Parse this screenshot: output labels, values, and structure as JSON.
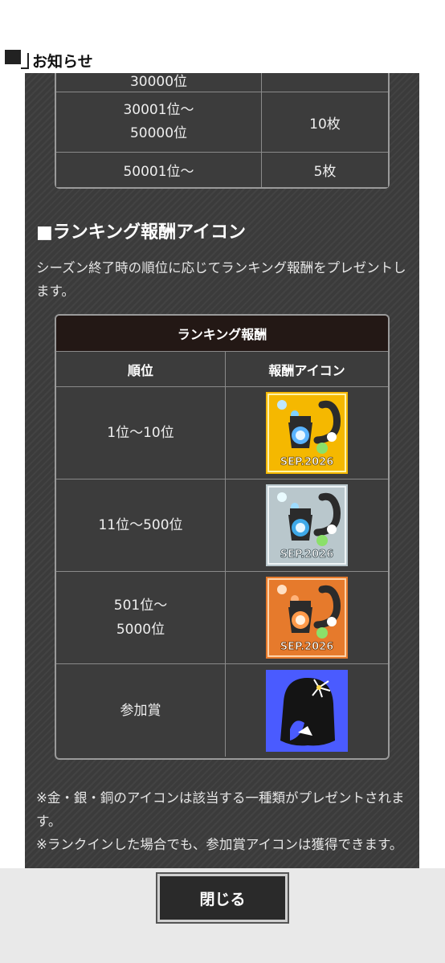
{
  "header": {
    "title": "お知らせ"
  },
  "top_table": {
    "rows": [
      {
        "rank": "30000位",
        "reward": ""
      },
      {
        "rank": "30001位〜\n50000位",
        "reward": "10枚"
      },
      {
        "rank": "50001位〜",
        "reward": "5枚"
      }
    ]
  },
  "section": {
    "heading": "■ランキング報酬アイコン",
    "description": "シーズン終了時の順位に応じてランキング報酬をプレゼントします。"
  },
  "ranking_table": {
    "caption": "ランキング報酬",
    "headers": [
      "順位",
      "報酬アイコン"
    ],
    "rows": [
      {
        "rank": "1位〜10位",
        "icon": "gold-lantern-cat-icon"
      },
      {
        "rank": "11位〜500位",
        "icon": "silver-lantern-cat-icon"
      },
      {
        "rank": "501位〜\n5000位",
        "icon": "bronze-lantern-cat-icon"
      },
      {
        "rank": "参加賞",
        "icon": "participation-silhouette-icon"
      }
    ],
    "icon_text": "SEP.2026"
  },
  "notes": [
    "※金・銀・銅のアイコンは該当する一種類がプレゼントされます。",
    "※ランクインした場合でも、参加賞アイコンは獲得できます。"
  ],
  "footer": {
    "close_label": "閉じる"
  },
  "colors": {
    "panel_bg": "#3b3b3b",
    "caption_bg": "#231815",
    "gold": "#f5b800",
    "silver": "#b9c7cc",
    "bronze": "#e67a2c",
    "participation": "#4a5bff"
  }
}
